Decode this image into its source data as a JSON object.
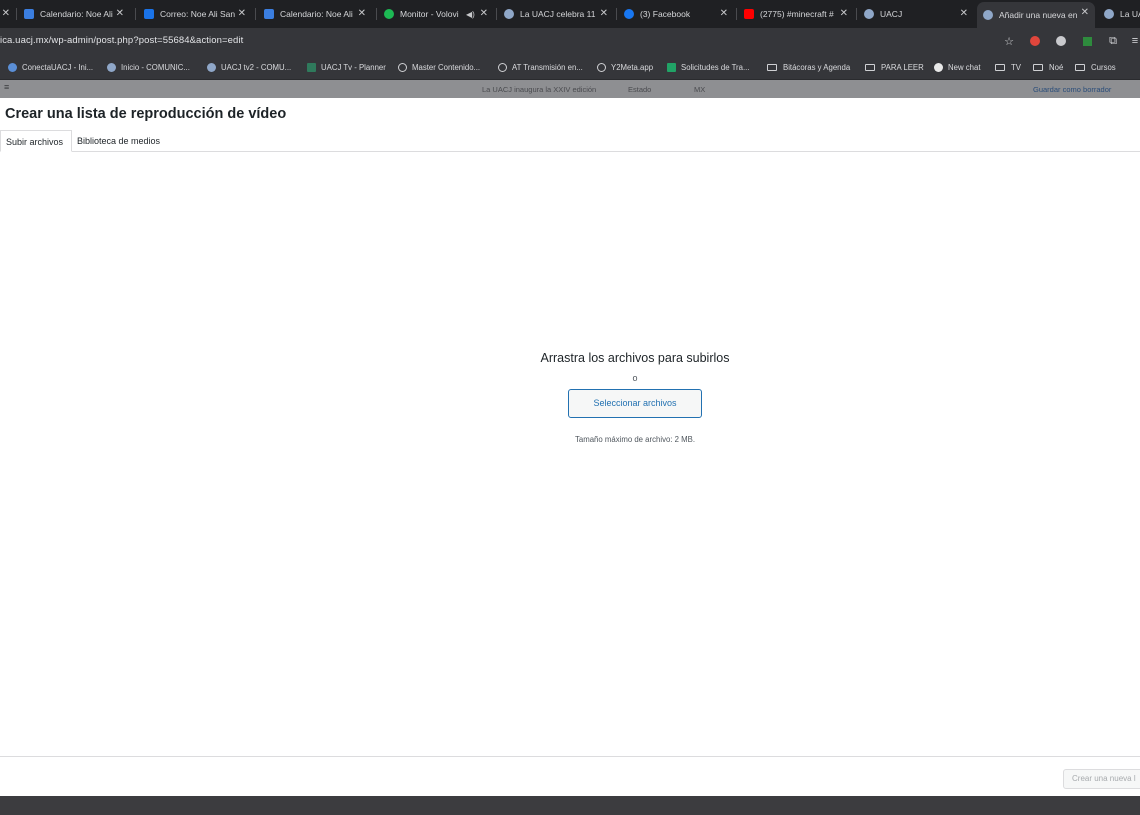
{
  "browser": {
    "tabs": [
      {
        "title": "",
        "favicon_color": "#1f2023",
        "closable": true
      },
      {
        "title": "Calendario: Noe Ali",
        "favicon_color": "#3b7ee0",
        "closable": true
      },
      {
        "title": "Correo: Noe Ali San",
        "favicon_color": "#1a73e8",
        "closable": true
      },
      {
        "title": "Calendario: Noe Ali",
        "favicon_color": "#3b7ee0",
        "closable": true
      },
      {
        "title": "Monitor - Volovi",
        "favicon_color": "#1db954",
        "closable": true,
        "audio": "◀)"
      },
      {
        "title": "La UACJ celebra 11",
        "favicon_color": "#8fa7c8",
        "closable": true
      },
      {
        "title": "(3) Facebook",
        "favicon_color": "#1877f2",
        "closable": true
      },
      {
        "title": "(2775) #minecraft #",
        "favicon_color": "#ff0000",
        "closable": true
      },
      {
        "title": "UACJ",
        "favicon_color": "#8fa7c8",
        "closable": true
      },
      {
        "title": "Añadir una nueva en",
        "favicon_color": "#8fa7c8",
        "closable": true,
        "active": true
      },
      {
        "title": "La UA",
        "favicon_color": "#8fa7c8",
        "closable": false
      }
    ],
    "close_glyph": "✕",
    "url": "ica.uacj.mx/wp-admin/post.php?post=55684&action=edit",
    "bookmarks": [
      {
        "label": "ConectaUACJ - Ini...",
        "icon": "circle",
        "color": "#5b8fd6"
      },
      {
        "label": "Inicio - COMUNIC...",
        "icon": "circle",
        "color": "#8fa7c8"
      },
      {
        "label": "UACJ tv2 - COMU...",
        "icon": "circle",
        "color": "#8fa7c8"
      },
      {
        "label": "UACJ Tv - Planner",
        "icon": "circle",
        "color": "#2f7a5c"
      },
      {
        "label": "Master Contenido...",
        "icon": "globe",
        "color": "#cfd0d3"
      },
      {
        "label": "AT Transmisión en...",
        "icon": "globe",
        "color": "#cfd0d3"
      },
      {
        "label": "Y2Meta.app",
        "icon": "globe",
        "color": "#cfd0d3"
      },
      {
        "label": "Solicitudes de Tra...",
        "icon": "circle",
        "color": "#21a366"
      },
      {
        "label": "Bitácoras y Agenda",
        "icon": "folder",
        "color": "#cfd0d3"
      },
      {
        "label": "PARA LEER",
        "icon": "folder",
        "color": "#cfd0d3"
      },
      {
        "label": "New chat",
        "icon": "circle",
        "color": "#e8e8e8"
      },
      {
        "label": "TV",
        "icon": "folder",
        "color": "#cfd0d3"
      },
      {
        "label": "Noé",
        "icon": "folder",
        "color": "#cfd0d3"
      },
      {
        "label": "Cursos",
        "icon": "folder",
        "color": "#cfd0d3"
      }
    ]
  },
  "background_page": {
    "strip_items": [
      "La UACJ inaugura la XXIV edición",
      "Estado",
      "MX",
      "Guardar como borrador"
    ]
  },
  "modal": {
    "title": "Crear una lista de reproducción de vídeo",
    "tabs": [
      {
        "label": "Subir archivos",
        "active": true
      },
      {
        "label": "Biblioteca de medios",
        "active": false
      }
    ],
    "upload": {
      "drop_text": "Arrastra los archivos para subirlos",
      "or_text": "o",
      "select_button": "Seleccionar archivos",
      "max_size": "Tamaño máximo de archivo: 2 MB."
    },
    "footer": {
      "create_button": "Crear una nueva l"
    }
  }
}
